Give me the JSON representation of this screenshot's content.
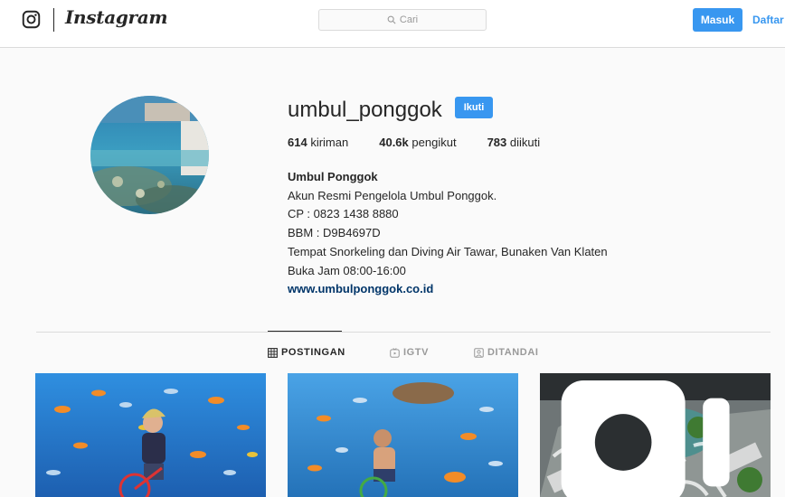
{
  "header": {
    "brand": "Instagram",
    "search": {
      "placeholder": "Cari"
    },
    "login_label": "Masuk",
    "signup_label": "Daftar"
  },
  "profile": {
    "username": "umbul_ponggok",
    "follow_label": "Ikuti",
    "stats": [
      {
        "value": "614",
        "label": "kiriman"
      },
      {
        "value": "40.6k",
        "label": "pengikut"
      },
      {
        "value": "783",
        "label": "diikuti"
      }
    ],
    "full_name": "Umbul Ponggok",
    "bio_lines": [
      "Akun Resmi Pengelola Umbul Ponggok.",
      "CP : 0823 1438 8880",
      "BBM : D9B4697D",
      "Tempat Snorkeling dan Diving Air Tawar, Bunaken Van Klaten",
      "Buka Jam 08:00-16:00"
    ],
    "website": "www.umbulponggok.co.id"
  },
  "tabs": [
    {
      "label": "POSTINGAN",
      "icon": "grid-icon",
      "active": true
    },
    {
      "label": "IGTV",
      "icon": "igtv-icon",
      "active": false
    },
    {
      "label": "DITANDAI",
      "icon": "tagged-icon",
      "active": false
    }
  ],
  "posts": [
    {
      "kind": "photo",
      "subject": "underwater-cyclist-woman"
    },
    {
      "kind": "photo",
      "subject": "underwater-cyclist-man"
    },
    {
      "kind": "video",
      "subject": "aerial-title-card",
      "badge_icon": "video-icon"
    }
  ],
  "colors": {
    "accent": "#3897f0",
    "link": "#003569",
    "text": "#262626",
    "muted": "#999999",
    "border": "#dbdbdb",
    "background": "#fafafa"
  }
}
